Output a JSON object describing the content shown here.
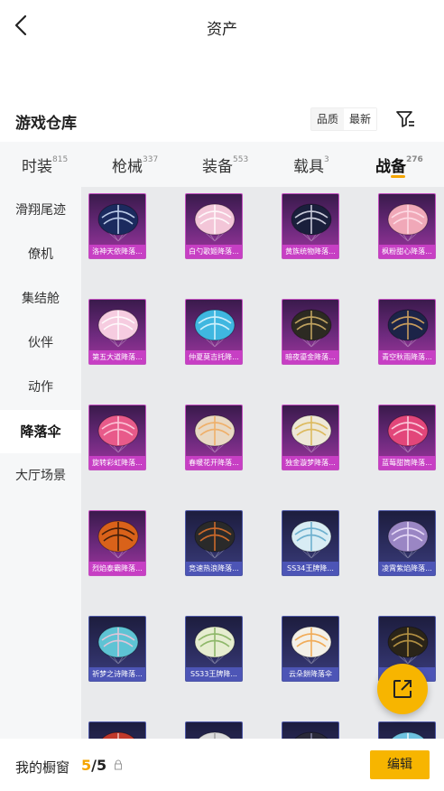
{
  "header": {
    "title": "资产"
  },
  "section": {
    "title": "游戏仓库"
  },
  "sort": {
    "options": [
      "品质",
      "最新"
    ],
    "active": 1
  },
  "tabs": [
    {
      "label": "时装",
      "count": "815"
    },
    {
      "label": "枪械",
      "count": "337"
    },
    {
      "label": "装备",
      "count": "553"
    },
    {
      "label": "载具",
      "count": "3"
    },
    {
      "label": "战备",
      "count": "276"
    }
  ],
  "sidebar": {
    "items": [
      "滑翔尾迹",
      "僚机",
      "集结舱",
      "伙伴",
      "动作",
      "降落伞",
      "大厅场景"
    ],
    "active_index": 5
  },
  "items": [
    {
      "name": "洛神天依降落...",
      "frame": "purple",
      "canopy": "#1b2a5e",
      "pattern": "#d7e6ff"
    },
    {
      "name": "白勺歌姬降落...",
      "frame": "purple",
      "canopy": "#f3c6d8",
      "pattern": "#ffffff"
    },
    {
      "name": "黄族统物降落...",
      "frame": "purple",
      "canopy": "#1a1f3c",
      "pattern": "#e8e8f4"
    },
    {
      "name": "枫粉甜心降落...",
      "frame": "purple",
      "canopy": "#f0a8b8",
      "pattern": "#ffe2ea"
    },
    {
      "name": "第五大道降落...",
      "frame": "purple",
      "canopy": "#f6cce0",
      "pattern": "#ffffff"
    },
    {
      "name": "仲夏莫吉托降...",
      "frame": "purple",
      "canopy": "#3fb7e0",
      "pattern": "#e7f9ff"
    },
    {
      "name": "暗夜鎏金降落...",
      "frame": "purple",
      "canopy": "#2c2a22",
      "pattern": "#d8b66a"
    },
    {
      "name": "青空秋雨降落...",
      "frame": "purple",
      "canopy": "#1c2448",
      "pattern": "#e6b060"
    },
    {
      "name": "旋转彩虹降落...",
      "frame": "purple",
      "canopy": "#e85a8a",
      "pattern": "#ffd6e4"
    },
    {
      "name": "春暖花开降落...",
      "frame": "purple",
      "canopy": "#e9d9c4",
      "pattern": "#f0a85a"
    },
    {
      "name": "独金漩梦降落...",
      "frame": "purple",
      "canopy": "#eee8d8",
      "pattern": "#d9b24a"
    },
    {
      "name": "蓝莓甜筒降落...",
      "frame": "purple",
      "canopy": "#e2467a",
      "pattern": "#ffe0ec"
    },
    {
      "name": "烈焰泰霸降落...",
      "frame": "purple",
      "canopy": "#d9621a",
      "pattern": "#2a1408"
    },
    {
      "name": "竞速热浪降落...",
      "frame": "navy",
      "canopy": "#2a2a2a",
      "pattern": "#e8742a"
    },
    {
      "name": "SS34王牌降...",
      "frame": "navy",
      "canopy": "#d8ecf4",
      "pattern": "#5aa6c8"
    },
    {
      "name": "凌霄紫焰降落...",
      "frame": "navy",
      "canopy": "#9a86c4",
      "pattern": "#f2e6ff"
    },
    {
      "name": "祈梦之诗降落...",
      "frame": "navy",
      "canopy": "#5ec3d4",
      "pattern": "#f6c6d8"
    },
    {
      "name": "SS33王牌降...",
      "frame": "navy",
      "canopy": "#e6edd0",
      "pattern": "#7fae58"
    },
    {
      "name": "云朵餅降落伞",
      "frame": "navy",
      "canopy": "#f3f0e8",
      "pattern": "#f0a040"
    },
    {
      "name": "降落...",
      "frame": "navy",
      "canopy": "#2a2418",
      "pattern": "#c9a24a"
    },
    {
      "name": "",
      "frame": "navy",
      "canopy": "#c0392b",
      "pattern": "#f5d2c8"
    },
    {
      "name": "",
      "frame": "navy",
      "canopy": "#dcdcdc",
      "pattern": "#9a9a9a"
    },
    {
      "name": "",
      "frame": "navy",
      "canopy": "#2a2a3a",
      "pattern": "#8888aa"
    },
    {
      "name": "",
      "frame": "navy",
      "canopy": "#6ec2e0",
      "pattern": "#ffffff"
    }
  ],
  "footer": {
    "showcase_label": "我的橱窗",
    "current": "5",
    "separator": "/",
    "total": "5",
    "edit_label": "编辑"
  },
  "icons": {
    "back": "chevron-left-icon",
    "filter": "filter-icon",
    "lock": "lock-icon",
    "share": "external-link-icon"
  },
  "colors": {
    "accent": "#f7b500",
    "rare_frame": "#c73fc4",
    "epic_frame": "#4d55b6"
  }
}
